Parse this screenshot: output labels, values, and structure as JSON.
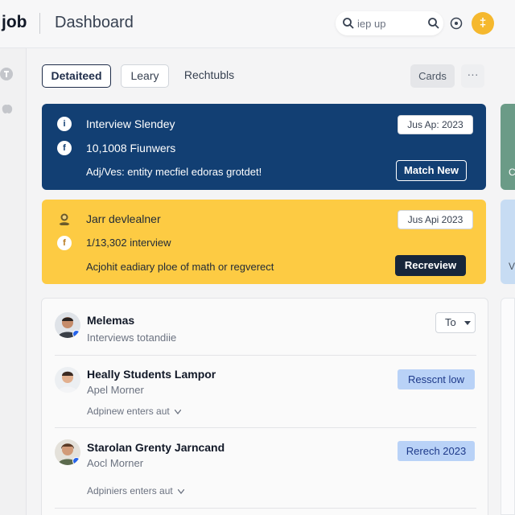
{
  "app": {
    "logo": "job",
    "title": "Dashboard"
  },
  "search": {
    "placeholder": "iep up"
  },
  "user": {
    "initial": "‡"
  },
  "tabs": [
    {
      "label": "Detaiteed"
    },
    {
      "label": "Leary"
    },
    {
      "label": "Rechtubls"
    }
  ],
  "view": {
    "cards_label": "Cards",
    "more_label": "···"
  },
  "cards": [
    {
      "lines": [
        "Interview Slendey",
        "10,1008 Fiunwers",
        "Adj/Ves: entity mecfiel edoras grotdet!"
      ],
      "icons": [
        "i",
        "f"
      ],
      "date": "Jus Ap: 2023",
      "action": "Match New"
    },
    {
      "lines": [
        "Jarr devlealner",
        "1/13,302 interview",
        "Acjohit eadiary ploe of math or regverect"
      ],
      "icons": [
        "",
        "f"
      ],
      "date": "Jus Api 2023",
      "action": "Recreview"
    }
  ],
  "edge_hints": {
    "green": "C",
    "blue": "V"
  },
  "list": [
    {
      "name": "Melemas",
      "sub": "Interviews totandiie",
      "control": "To"
    },
    {
      "name": "Heally Students Lampor",
      "sub": "Apel Morner",
      "expand": "Adpinew enters aut",
      "status": "Resscnt low"
    },
    {
      "name": "Starolan Grenty Jarncand",
      "sub": "Aocl Morner",
      "expand": "Adpiniers enters aut",
      "status": "Rerech 2023"
    }
  ],
  "colors": {
    "primary": "#123f73",
    "warning": "#fdcb43",
    "avatar": "#f5b82e",
    "pill": "#b9d2f7"
  },
  "icon_names": [
    "search-icon",
    "clear-search-icon",
    "help-icon",
    "info-icon",
    "facebook-icon",
    "user-icon",
    "chevron-down-icon"
  ]
}
